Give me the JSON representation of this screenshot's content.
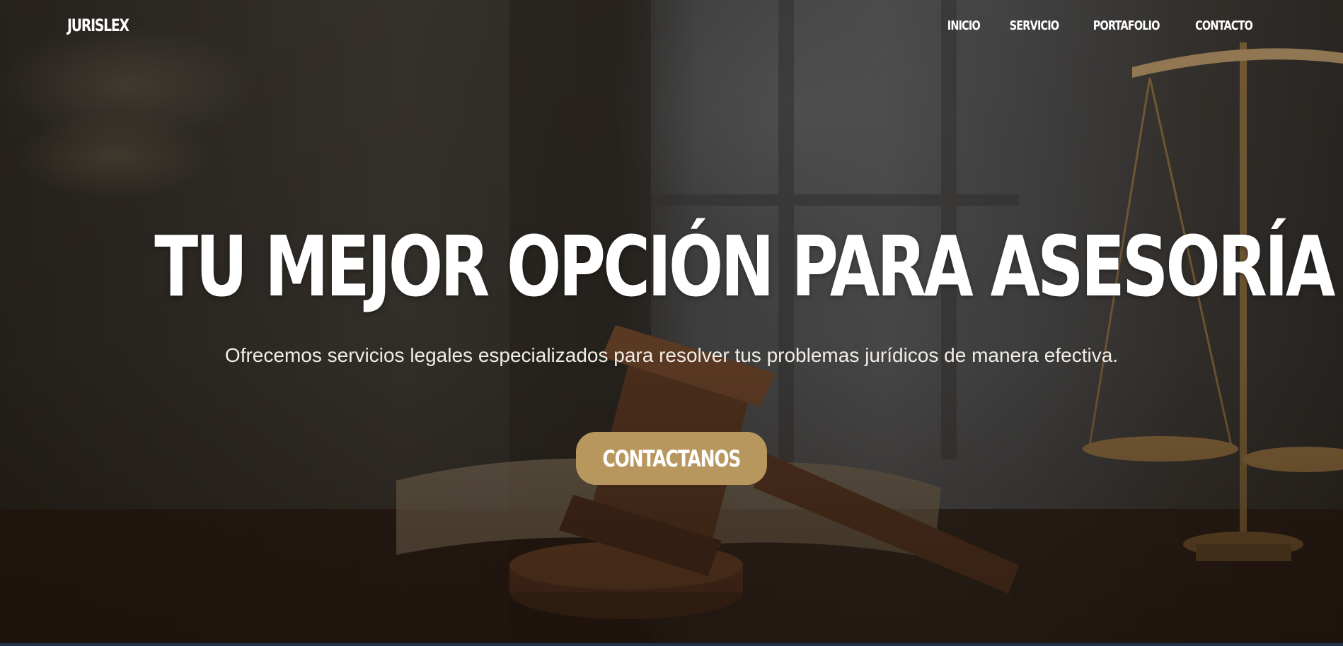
{
  "nav": {
    "brand": "JURISLEX",
    "links": [
      {
        "label": "INICIO"
      },
      {
        "label": "SERVICIO"
      },
      {
        "label": "PORTAFOLIO"
      },
      {
        "label": "CONTACTO"
      }
    ]
  },
  "hero": {
    "title": "TU MEJOR OPCIÓN PARA ASESORÍA LEGAL",
    "subtitle": "Ofrecemos servicios legales especializados para resolver tus problemas jurídicos de manera efectiva.",
    "cta_label": "CONTACTANOS",
    "background_image": "courtroom-gavel-and-scales-photo"
  },
  "colors": {
    "accent": "#b8975f",
    "text": "#ffffff",
    "bottom_rule": "#23304a"
  }
}
